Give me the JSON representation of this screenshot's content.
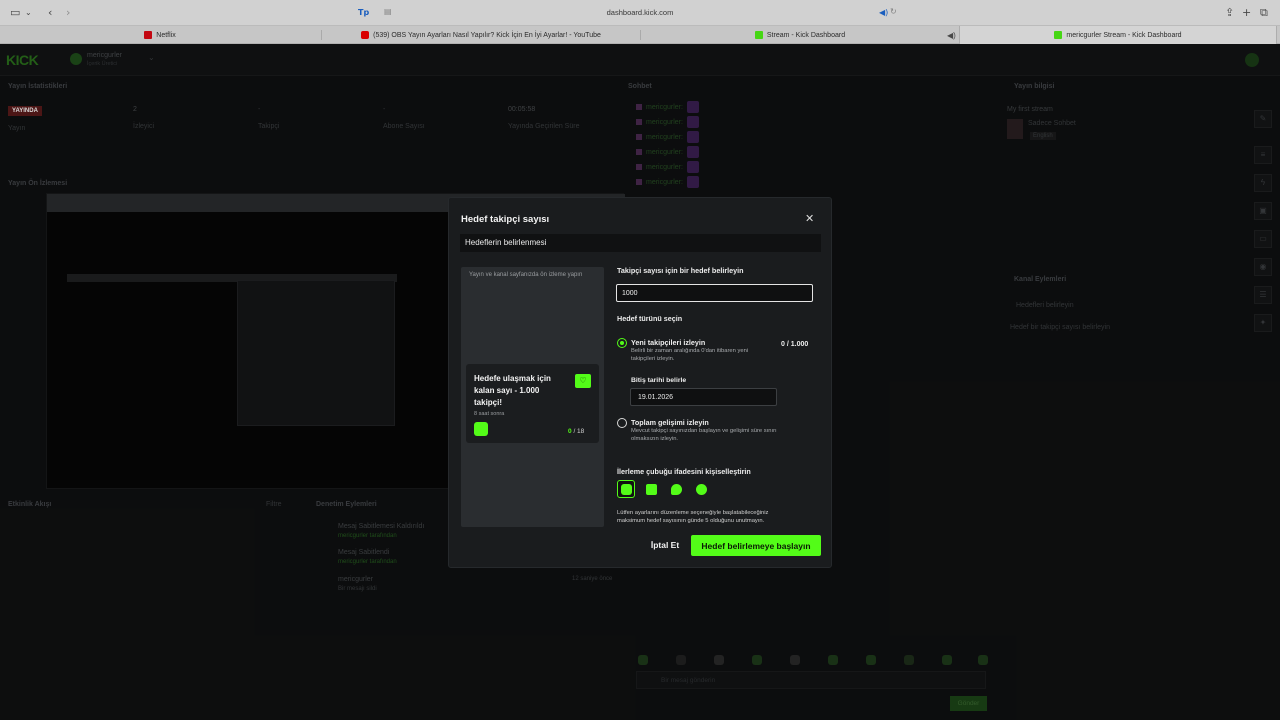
{
  "browser": {
    "url": "dashboard.kick.com",
    "tabs": [
      {
        "label": "Netflix",
        "icon": "netflix-icon",
        "color": "#e50914"
      },
      {
        "label": "(539) OBS Yayın Ayarları Nasıl Yapılır? Kick İçin En İyi Ayarlar! - YouTube",
        "icon": "youtube-icon",
        "color": "#ff0000"
      },
      {
        "label": "Stream - Kick Dashboard",
        "icon": "kick-icon",
        "color": "#53fc18"
      },
      {
        "label": "mericgurler Stream - Kick Dashboard",
        "icon": "kick-icon",
        "color": "#53fc18"
      }
    ]
  },
  "dashboard": {
    "logo": "KICK",
    "username": "mericgurler",
    "user_sub": "İçerik Üretici",
    "stats": {
      "title": "Yayın İstatistikleri",
      "live_badge": "YAYINDA",
      "stream_label": "Yayın",
      "viewers_value": "2",
      "viewers_label": "İzleyici",
      "followers_value": "-",
      "followers_label": "Takipçi",
      "subs_value": "-",
      "subs_label": "Abone Sayısı",
      "uptime_value": "00:05:58",
      "uptime_label": "Yayında Geçirilen Süre"
    },
    "preview_title": "Yayın Ön İzlemesi",
    "chat_title": "Sohbet",
    "chat_user": "mericgurler:",
    "stream_info": {
      "title": "Yayın bilgisi",
      "stream_name": "My first stream",
      "category": "Sadece Sohbet",
      "tag": "English"
    },
    "channel_actions": {
      "title": "Kanal Eylemleri",
      "back_label": "Hedefleri belirleyin",
      "hint": "Hedef bir takipçi sayısı belirleyin"
    },
    "activity": {
      "title": "Etkinlik Akışı",
      "filter": "Filtre"
    },
    "mod_actions": {
      "title": "Denetim Eylemleri",
      "items": [
        {
          "title": "Mesaj Sabitlemesi Kaldırıldı",
          "sub": "mericgurler tarafından"
        },
        {
          "title": "Mesaj Sabitlendi",
          "sub": "mericgurler tarafından"
        },
        {
          "title": "mericgurler",
          "sub": "Bir mesajı sildi"
        }
      ],
      "time": "12 saniye önce"
    },
    "chat_placeholder": "Bir mesaj gönderin",
    "send_label": "Gönder"
  },
  "modal": {
    "title": "Hedef takipçi sayısı",
    "section": "Hedeflerin belirlenmesi",
    "preview_hint": "Yayın ve kanal sayfanızda ön izleme yapın",
    "card_title": "Hedefe ulaşmak için kalan sayı - 1.000 takipçi!",
    "card_time": "8 saat sonra",
    "card_progress_current": "0",
    "card_progress_total": "/ 18",
    "goal_label": "Takipçi sayısı için bir hedef belirleyin",
    "goal_value": "1000",
    "type_label": "Hedef türünü seçin",
    "option_new": {
      "title": "Yeni takipçileri izleyin",
      "desc": "Belirli bir zaman aralığında 0'dan itibaren yeni takipçileri izleyin.",
      "counter": "0 / 1.000",
      "selected": true
    },
    "end_date_label": "Bitiş tarihi belirle",
    "end_date_value": "19.01.2026",
    "option_total": {
      "title": "Toplam gelişimi izleyin",
      "desc": "Mevcut takipçi sayınızdan başlayın ve gelişimi süre sınırı olmaksızın izleyin.",
      "selected": false
    },
    "style_label": "İlerleme çubuğu ifadesini kişiselleştirin",
    "styles": [
      "rocket-emote-icon",
      "smile-emote-icon",
      "chat-emote-icon",
      "heart-emote-icon"
    ],
    "note": "Lütfen ayarlarını düzenleme seçeneğiyle başlatabileceğiniz maksimum hedef sayısının günde 5 olduğunu unutmayın.",
    "cancel_label": "İptal Et",
    "submit_label": "Hedef belirlemeye başlayın",
    "accent": "#53fc18"
  }
}
